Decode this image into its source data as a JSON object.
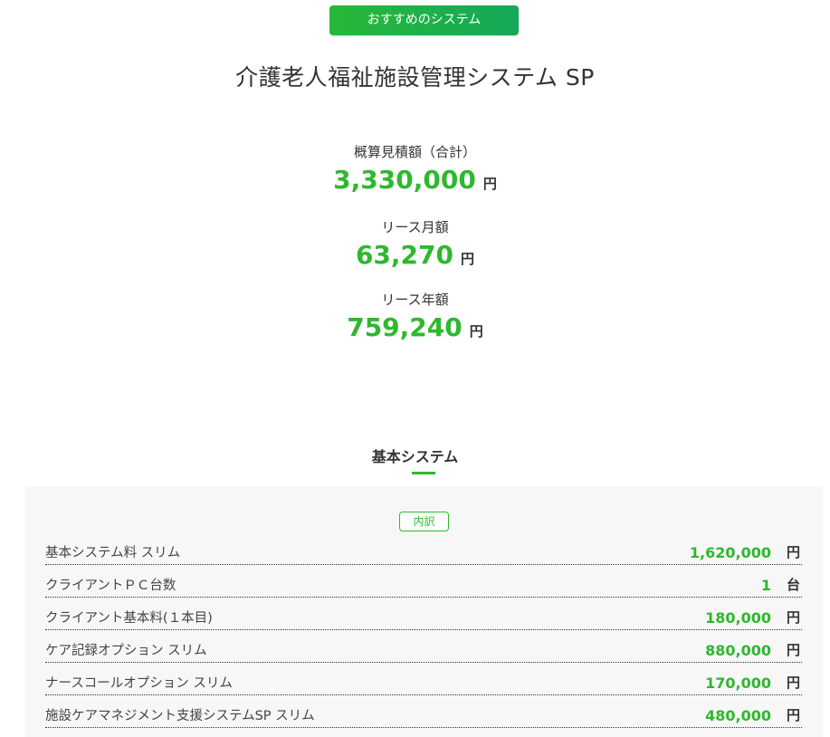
{
  "badge": {
    "label": "おすすめのシステム"
  },
  "product": {
    "title": "介護老人福祉施設管理システム SP"
  },
  "estimates": [
    {
      "label": "概算見積額（合計）",
      "value": "3,330,000",
      "unit": "円"
    },
    {
      "label": "リース月額",
      "value": "63,270",
      "unit": "円"
    },
    {
      "label": "リース年額",
      "value": "759,240",
      "unit": "円"
    }
  ],
  "section": {
    "title": "基本システム",
    "breakdown_label": "内訳"
  },
  "items": [
    {
      "label": "基本システム料 スリム",
      "value": "1,620,000",
      "unit": "円"
    },
    {
      "label": "クライアントＰＣ台数",
      "value": "1",
      "unit": "台"
    },
    {
      "label": "クライアント基本料(１本目)",
      "value": "180,000",
      "unit": "円"
    },
    {
      "label": "ケア記録オプション スリム",
      "value": "880,000",
      "unit": "円"
    },
    {
      "label": "ナースコールオプション スリム",
      "value": "170,000",
      "unit": "円"
    },
    {
      "label": "施設ケアマネジメント支援システムSP スリム",
      "value": "480,000",
      "unit": "円"
    }
  ],
  "colors": {
    "accent": "#2eb82e",
    "badge_start": "#28b838",
    "badge_end": "#15a85a",
    "panel_bg": "#f7f7f7"
  }
}
